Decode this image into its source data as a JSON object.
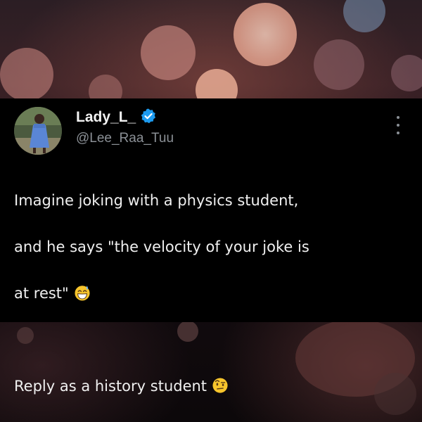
{
  "tweet": {
    "display_name": "Lady_L_",
    "handle": "@Lee_Raa_Tuu",
    "verified_icon": "verified-badge-icon",
    "more_icon": "more-options-icon",
    "lines": [
      "Imagine joking with a physics student,",
      "and he says \"the velocity of your joke is",
      "at rest\"",
      "",
      "Reply as a history student"
    ],
    "emoji_1": "grinning-sweat-emoji",
    "emoji_2": "raised-eyebrow-emoji"
  },
  "colors": {
    "tweet_background": "#000000",
    "text": "#e7e9ea",
    "handle": "#8b9096",
    "verified": "#1d9bf0"
  }
}
